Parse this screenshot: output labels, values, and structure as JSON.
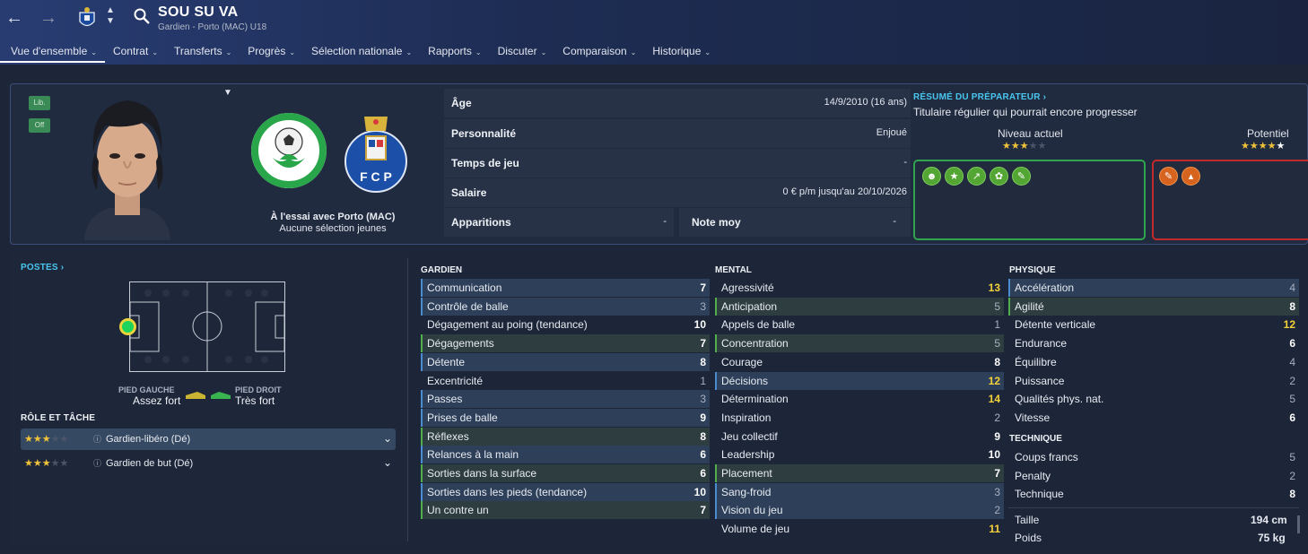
{
  "header": {
    "player_name": "SOU SU VA",
    "subtitle": "Gardien - Porto (MAC) U18",
    "back_icon": "arrow-left-icon",
    "forward_icon": "arrow-right-icon",
    "search_icon": "search-icon"
  },
  "tabs": [
    {
      "label": "Vue d'ensemble",
      "active": true
    },
    {
      "label": "Contrat"
    },
    {
      "label": "Transferts"
    },
    {
      "label": "Progrès"
    },
    {
      "label": "Sélection nationale"
    },
    {
      "label": "Rapports"
    },
    {
      "label": "Discuter"
    },
    {
      "label": "Comparaison"
    },
    {
      "label": "Historique"
    }
  ],
  "profile": {
    "tag_lib": "Lib.",
    "tag_off": "Off",
    "trial_text": "À l'essai avec Porto (MAC)",
    "youth_text": "Aucune sélection jeunes",
    "club_a_text": "ASSOCIAÇÃO DE FUTEBOL DE MACAU",
    "club_b_text": "F C P"
  },
  "info": {
    "age_label": "Âge",
    "age_value": "14/9/2010 (16 ans)",
    "personality_label": "Personnalité",
    "personality_value": "Enjoué",
    "playtime_label": "Temps de jeu",
    "playtime_value": "-",
    "salary_label": "Salaire",
    "salary_value": "0 € p/m jusqu'au 20/10/2026",
    "apps_label": "Apparitions",
    "apps_value": "-",
    "rating_label": "Note moy",
    "rating_value": "-"
  },
  "summary": {
    "title": "RÉSUMÉ DU PRÉPARATEUR",
    "text": "Titulaire régulier qui pourrait encore progresser",
    "current_label": "Niveau actuel",
    "current_stars": 3,
    "potential_label": "Potentiel",
    "potential_stars": 4.5
  },
  "positions": {
    "title": "POSTES",
    "left_foot_label": "PIED GAUCHE",
    "left_foot_value": "Assez fort",
    "right_foot_label": "PIED DROIT",
    "right_foot_value": "Très fort"
  },
  "roles": {
    "title": "RÔLE ET TÂCHE",
    "items": [
      {
        "name": "Gardien-libéro (Dé)",
        "stars": 3
      },
      {
        "name": "Gardien de but (Dé)",
        "stars": 3
      }
    ]
  },
  "attributes": {
    "gk_title": "GARDIEN",
    "mental_title": "MENTAL",
    "phys_title": "PHYSIQUE",
    "tech_title": "TECHNIQUE",
    "gk": [
      {
        "name": "Communication",
        "value": "7"
      },
      {
        "name": "Contrôle de balle",
        "value": "3"
      },
      {
        "name": "Dégagement au poing (tendance)",
        "value": "10"
      },
      {
        "name": "Dégagements",
        "value": "7"
      },
      {
        "name": "Détente",
        "value": "8"
      },
      {
        "name": "Excentricité",
        "value": "1"
      },
      {
        "name": "Passes",
        "value": "3"
      },
      {
        "name": "Prises de balle",
        "value": "9"
      },
      {
        "name": "Réflexes",
        "value": "8"
      },
      {
        "name": "Relances à la main",
        "value": "6"
      },
      {
        "name": "Sorties dans la surface",
        "value": "6"
      },
      {
        "name": "Sorties dans les pieds (tendance)",
        "value": "10"
      },
      {
        "name": "Un contre un",
        "value": "7"
      }
    ],
    "mental": [
      {
        "name": "Agressivité",
        "value": "13"
      },
      {
        "name": "Anticipation",
        "value": "5"
      },
      {
        "name": "Appels de balle",
        "value": "1"
      },
      {
        "name": "Concentration",
        "value": "5"
      },
      {
        "name": "Courage",
        "value": "8"
      },
      {
        "name": "Décisions",
        "value": "12"
      },
      {
        "name": "Détermination",
        "value": "14"
      },
      {
        "name": "Inspiration",
        "value": "2"
      },
      {
        "name": "Jeu collectif",
        "value": "9"
      },
      {
        "name": "Leadership",
        "value": "10"
      },
      {
        "name": "Placement",
        "value": "7"
      },
      {
        "name": "Sang-froid",
        "value": "3"
      },
      {
        "name": "Vision du jeu",
        "value": "2"
      },
      {
        "name": "Volume de jeu",
        "value": "11"
      }
    ],
    "phys": [
      {
        "name": "Accélération",
        "value": "4"
      },
      {
        "name": "Agilité",
        "value": "8"
      },
      {
        "name": "Détente verticale",
        "value": "12"
      },
      {
        "name": "Endurance",
        "value": "6"
      },
      {
        "name": "Équilibre",
        "value": "4"
      },
      {
        "name": "Puissance",
        "value": "2"
      },
      {
        "name": "Qualités phys. nat.",
        "value": "5"
      },
      {
        "name": "Vitesse",
        "value": "6"
      }
    ],
    "tech": [
      {
        "name": "Coups francs",
        "value": "5"
      },
      {
        "name": "Penalty",
        "value": "2"
      },
      {
        "name": "Technique",
        "value": "8"
      }
    ],
    "height_label": "Taille",
    "height_value": "194 cm",
    "weight_label": "Poids",
    "weight_value": "75 kg"
  }
}
